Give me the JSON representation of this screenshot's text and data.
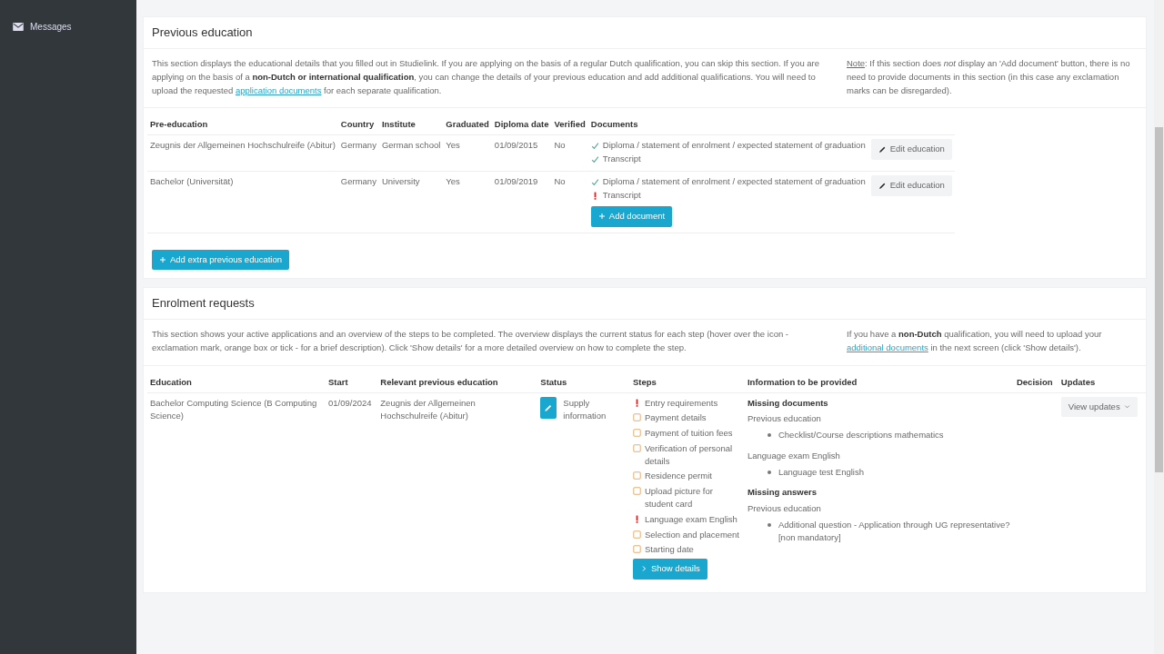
{
  "sidebar": {
    "items": [
      {
        "label": "Messages"
      }
    ]
  },
  "previous_education": {
    "title": "Previous education",
    "description": {
      "text_before": "This section displays the educational details that you filled out in Studielink. If you are applying on the basis of a regular Dutch qualification, you can skip this section. If you are applying on the basis of a **non-Dutch or international qualification**, you can change the details of your previous education and add additional qualifications. You will need to upload the requested ",
      "link": "application documents",
      "text_after": " for each separate qualification."
    },
    "note": {
      "label": "Note",
      "text": ": If this section does *not* display an 'Add document' button, there is no need to provide documents in this section (in this case any exclamation marks can be disregarded)."
    },
    "columns": [
      "Pre-education",
      "Country",
      "Institute",
      "Graduated",
      "Diploma date",
      "Verified",
      "Documents"
    ],
    "rows": [
      {
        "pre_education": "Zeugnis der Allgemeinen Hochschulreife (Abitur)",
        "country": "Germany",
        "institute": "German school",
        "graduated": "Yes",
        "diploma_date": "01/09/2015",
        "verified": "No",
        "documents": [
          {
            "label": "Diploma / statement of enrolment / expected statement of graduation",
            "kind": "done"
          },
          {
            "label": "Transcript",
            "kind": "done"
          }
        ],
        "action": "Edit education"
      },
      {
        "pre_education": "Bachelor (Universität)",
        "country": "Germany",
        "institute": "University",
        "graduated": "Yes",
        "diploma_date": "01/09/2019",
        "verified": "No",
        "documents": [
          {
            "label": "Diploma / statement of enrolment / expected statement of graduation",
            "kind": "done"
          },
          {
            "label": "Transcript",
            "kind": "missing"
          }
        ],
        "action": "Edit education",
        "add_button": "Add document"
      }
    ],
    "add_button": "Add extra previous education"
  },
  "enrolment_requests": {
    "title": "Enrolment requests",
    "description": "This section shows your active applications and an overview of the steps to be completed. The overview displays the current status for each step (hover over the icon - exclamation mark, orange box or tick - for a brief description). Click 'Show details' for a more detailed overview on how to complete the step.",
    "note": {
      "text_before": "If you have a **non-Dutch** qualification, you will need to upload your ",
      "link": "additional documents",
      "text_after": " in the next screen (click 'Show details')."
    },
    "columns": [
      "Education",
      "Start",
      "Relevant previous education",
      "Status",
      "Steps",
      "Information to be provided",
      "Decision",
      "Updates"
    ],
    "rows": [
      {
        "education": "Bachelor Computing Science (B Computing Science)",
        "start": "01/09/2024",
        "previous_education": "Zeugnis der Allgemeinen Hochschulreife (Abitur)",
        "status": "Supply information",
        "steps": [
          {
            "label": "Entry requirements",
            "kind": "missing"
          },
          {
            "label": "Payment details",
            "kind": "pending"
          },
          {
            "label": "Payment of tuition fees",
            "kind": "pending"
          },
          {
            "label": "Verification of personal details",
            "kind": "pending"
          },
          {
            "label": "Residence permit",
            "kind": "pending"
          },
          {
            "label": "Upload picture for student card",
            "kind": "pending"
          },
          {
            "label": "Language exam English",
            "kind": "missing"
          },
          {
            "label": "Selection and placement",
            "kind": "pending"
          },
          {
            "label": "Starting date",
            "kind": "pending"
          }
        ],
        "show_details": "Show details",
        "information": [
          {
            "heading": "Missing documents",
            "groups": [
              {
                "title": "Previous education",
                "items": [
                  "Checklist/Course descriptions mathematics"
                ]
              },
              {
                "title": "Language exam English",
                "items": [
                  "Language test English"
                ]
              }
            ]
          },
          {
            "heading": "Missing answers",
            "groups": [
              {
                "title": "Previous education",
                "items": [
                  "Additional question - Application through UG representative? [non mandatory]"
                ]
              }
            ]
          }
        ],
        "updates": "View updates"
      }
    ]
  }
}
